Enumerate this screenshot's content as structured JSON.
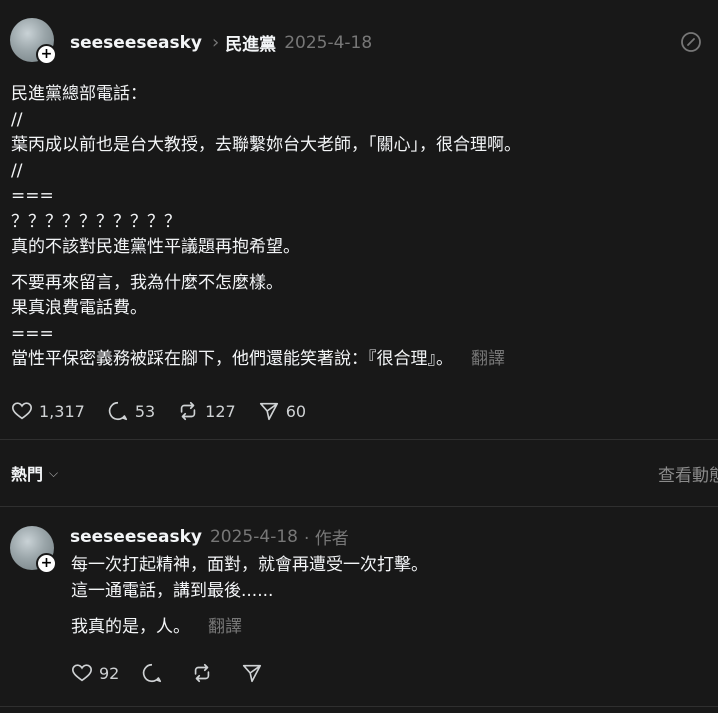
{
  "post": {
    "username": "seeseeseasky",
    "separator": "›",
    "topic": "民進黨",
    "date": "2025-4-18",
    "lines": [
      "民進黨總部電話：",
      "//",
      "葉丙成以前也是台大教授，去聯繫妳台大老師，「關心」，很合理啊。",
      "//",
      "===",
      "？？？？？？？？？？",
      "真的不該對民進黨性平議題再抱希望。",
      "",
      "不要再來留言，我為什麼不怎麼樣。",
      "果真浪費電話費。",
      "===",
      "當性平保密義務被踩在腳下，他們還能笑著說：『很合理』。"
    ],
    "translate": "翻譯",
    "likes": "1,317",
    "comments": "53",
    "reposts": "127",
    "shares": "60"
  },
  "sort": {
    "label": "熱門"
  },
  "view_activity": "查看動態",
  "reply": {
    "username": "seeseeseasky",
    "date": "2025-4-18",
    "author_tag": "· 作者",
    "lines": [
      "每一次打起精神，面對，就會再遭受一次打擊。",
      "這一通電話，講到最後......"
    ],
    "extra_line": "我真的是，人。",
    "translate": "翻譯",
    "likes": "92"
  }
}
